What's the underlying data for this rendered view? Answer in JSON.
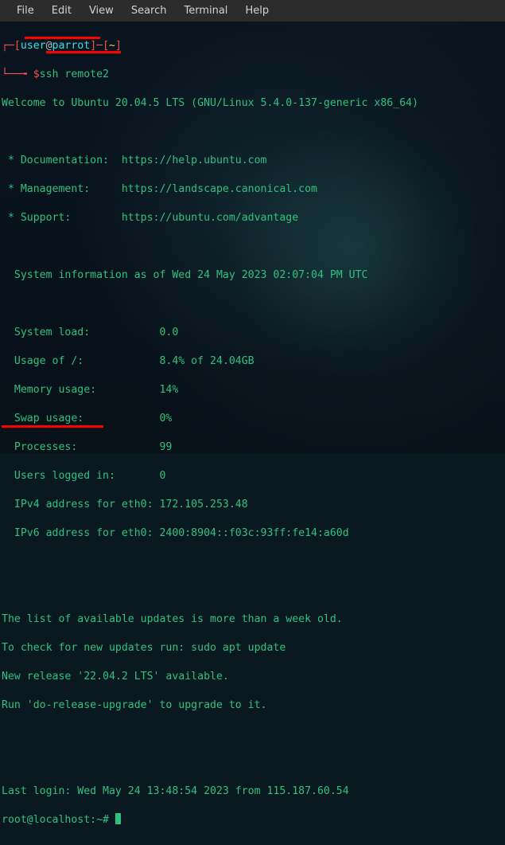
{
  "menubar": {
    "items": [
      "File",
      "Edit",
      "View",
      "Search",
      "Terminal",
      "Help"
    ]
  },
  "prompt1": {
    "pre": "┌─[",
    "user": "user",
    "at": "@",
    "host": "parrot",
    "post_host": "]─[",
    "cwd": "~",
    "post_cwd": "]"
  },
  "prompt2": {
    "pre": "└──╼ ",
    "sym": "$",
    "cmd": "ssh remote2"
  },
  "banner": {
    "welcome": "Welcome to Ubuntu 20.04.5 LTS (GNU/Linux 5.4.0-137-generic x86_64)",
    "doc": " * Documentation:  https://help.ubuntu.com",
    "mgmt": " * Management:     https://landscape.canonical.com",
    "support": " * Support:        https://ubuntu.com/advantage"
  },
  "sysinfo": {
    "header": "  System information as of Wed 24 May 2023 02:07:04 PM UTC",
    "load": "  System load:           0.0",
    "usage": "  Usage of /:            8.4% of 24.04GB",
    "mem": "  Memory usage:          14%",
    "swap": "  Swap usage:            0%",
    "proc": "  Processes:             99",
    "users": "  Users logged in:       0",
    "ipv4": "  IPv4 address for eth0: 172.105.253.48",
    "ipv6": "  IPv6 address for eth0: 2400:8904::f03c:93ff:fe14:a60d"
  },
  "updates": {
    "l1": "The list of available updates is more than a week old.",
    "l2": "To check for new updates run: sudo apt update",
    "l3": "New release '22.04.2 LTS' available.",
    "l4": "Run 'do-release-upgrade' to upgrade to it."
  },
  "lastlogin": "Last login: Wed May 24 13:48:54 2023 from 115.187.60.54",
  "rootprompt": "root@localhost:~# "
}
